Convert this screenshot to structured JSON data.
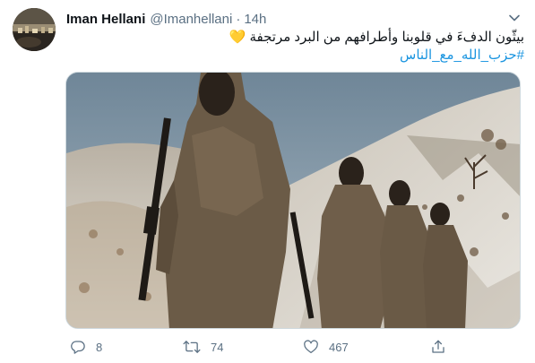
{
  "tweet": {
    "display_name": "Iman Hellani",
    "handle": "@Imanhellani",
    "separator": "·",
    "timestamp": "14h",
    "text_line1": "بيثّون الدفءَ في قلوبنا وأطرافهم من البرد مرتجفة",
    "heart_emoji": "💛",
    "hashtag": "#حزب_الله_مع_الناس"
  },
  "actions": {
    "reply_count": "8",
    "retweet_count": "74",
    "like_count": "467"
  },
  "icons": {
    "more": "chevron-down-icon",
    "reply": "reply-bubble-icon",
    "retweet": "retweet-icon",
    "like": "heart-icon",
    "share": "share-icon"
  },
  "colors": {
    "text_primary": "#0f1419",
    "text_secondary": "#5b7083",
    "link": "#1b95e0",
    "heart_emoji": "#f5b82e"
  }
}
